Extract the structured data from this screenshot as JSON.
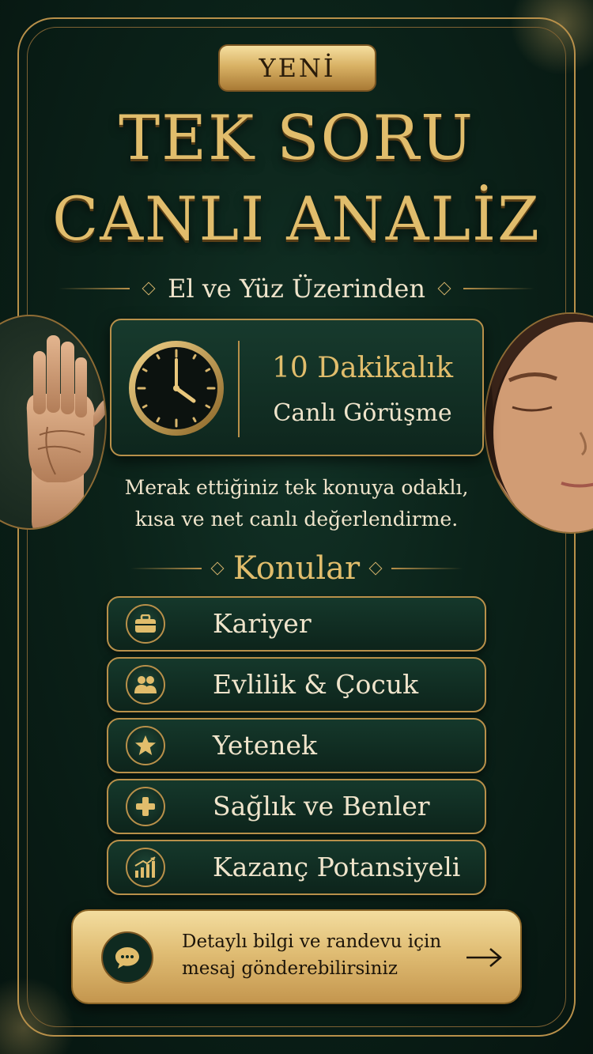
{
  "badge": "YENİ",
  "title_line1": "TEK SORU",
  "title_line2": "CANLI ANALİZ",
  "subtitle": "El ve Yüz Üzerinden",
  "info": {
    "duration": "10 Dakikalık",
    "meeting": "Canlı Görüşme"
  },
  "description": {
    "line1": "Merak ettiğiniz tek konuya odaklı,",
    "line2": "kısa ve net canlı değerlendirme."
  },
  "section_title": "Konular",
  "topics": [
    {
      "label": "Kariyer",
      "icon": "briefcase-icon"
    },
    {
      "label": "Evlilik & Çocuk",
      "icon": "people-icon"
    },
    {
      "label": "Yetenek",
      "icon": "star-icon"
    },
    {
      "label": "Sağlık ve Benler",
      "icon": "plus-icon"
    },
    {
      "label": "Kazanç Potansiyeli",
      "icon": "growth-chart-icon"
    }
  ],
  "cta": {
    "line1": "Detaylı bilgi ve randevu için",
    "line2": "mesaj gönderebilirsiniz",
    "icon": "chat-bubble-icon",
    "arrow_icon": "arrow-right-icon"
  },
  "colors": {
    "background": "#0b2219",
    "gold": "#e1bd6c",
    "border_gold": "#b8904a",
    "cream": "#efe4cb"
  }
}
